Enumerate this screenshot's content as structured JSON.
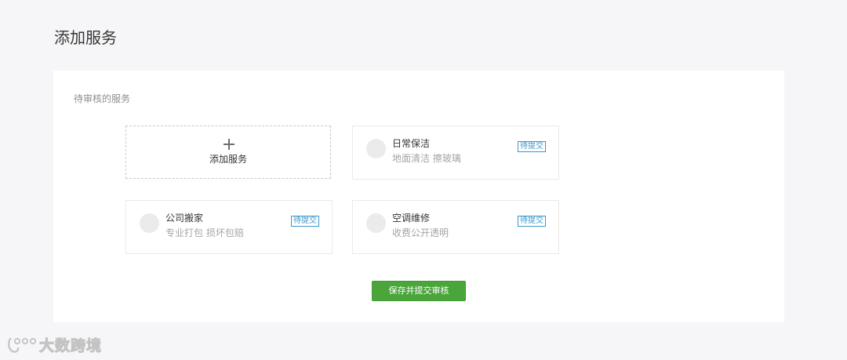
{
  "page": {
    "title": "添加服务"
  },
  "panel": {
    "section_label": "待审核的服务",
    "add_card": {
      "label": "添加服务",
      "icon": "plus-icon"
    },
    "services": [
      {
        "name": "日常保洁",
        "description": "地面清洁 擦玻璃",
        "status": "待提交"
      },
      {
        "name": "公司搬家",
        "description": "专业打包 损坏包赔",
        "status": "待提交"
      },
      {
        "name": "空调维修",
        "description": "收费公开透明",
        "status": "待提交"
      }
    ],
    "submit_label": "保存并提交审核"
  },
  "watermark": {
    "text": "大数跨境"
  },
  "colors": {
    "accent_green": "#4aa53b",
    "badge_blue": "#3a97c8",
    "background": "#f6f6f8"
  }
}
